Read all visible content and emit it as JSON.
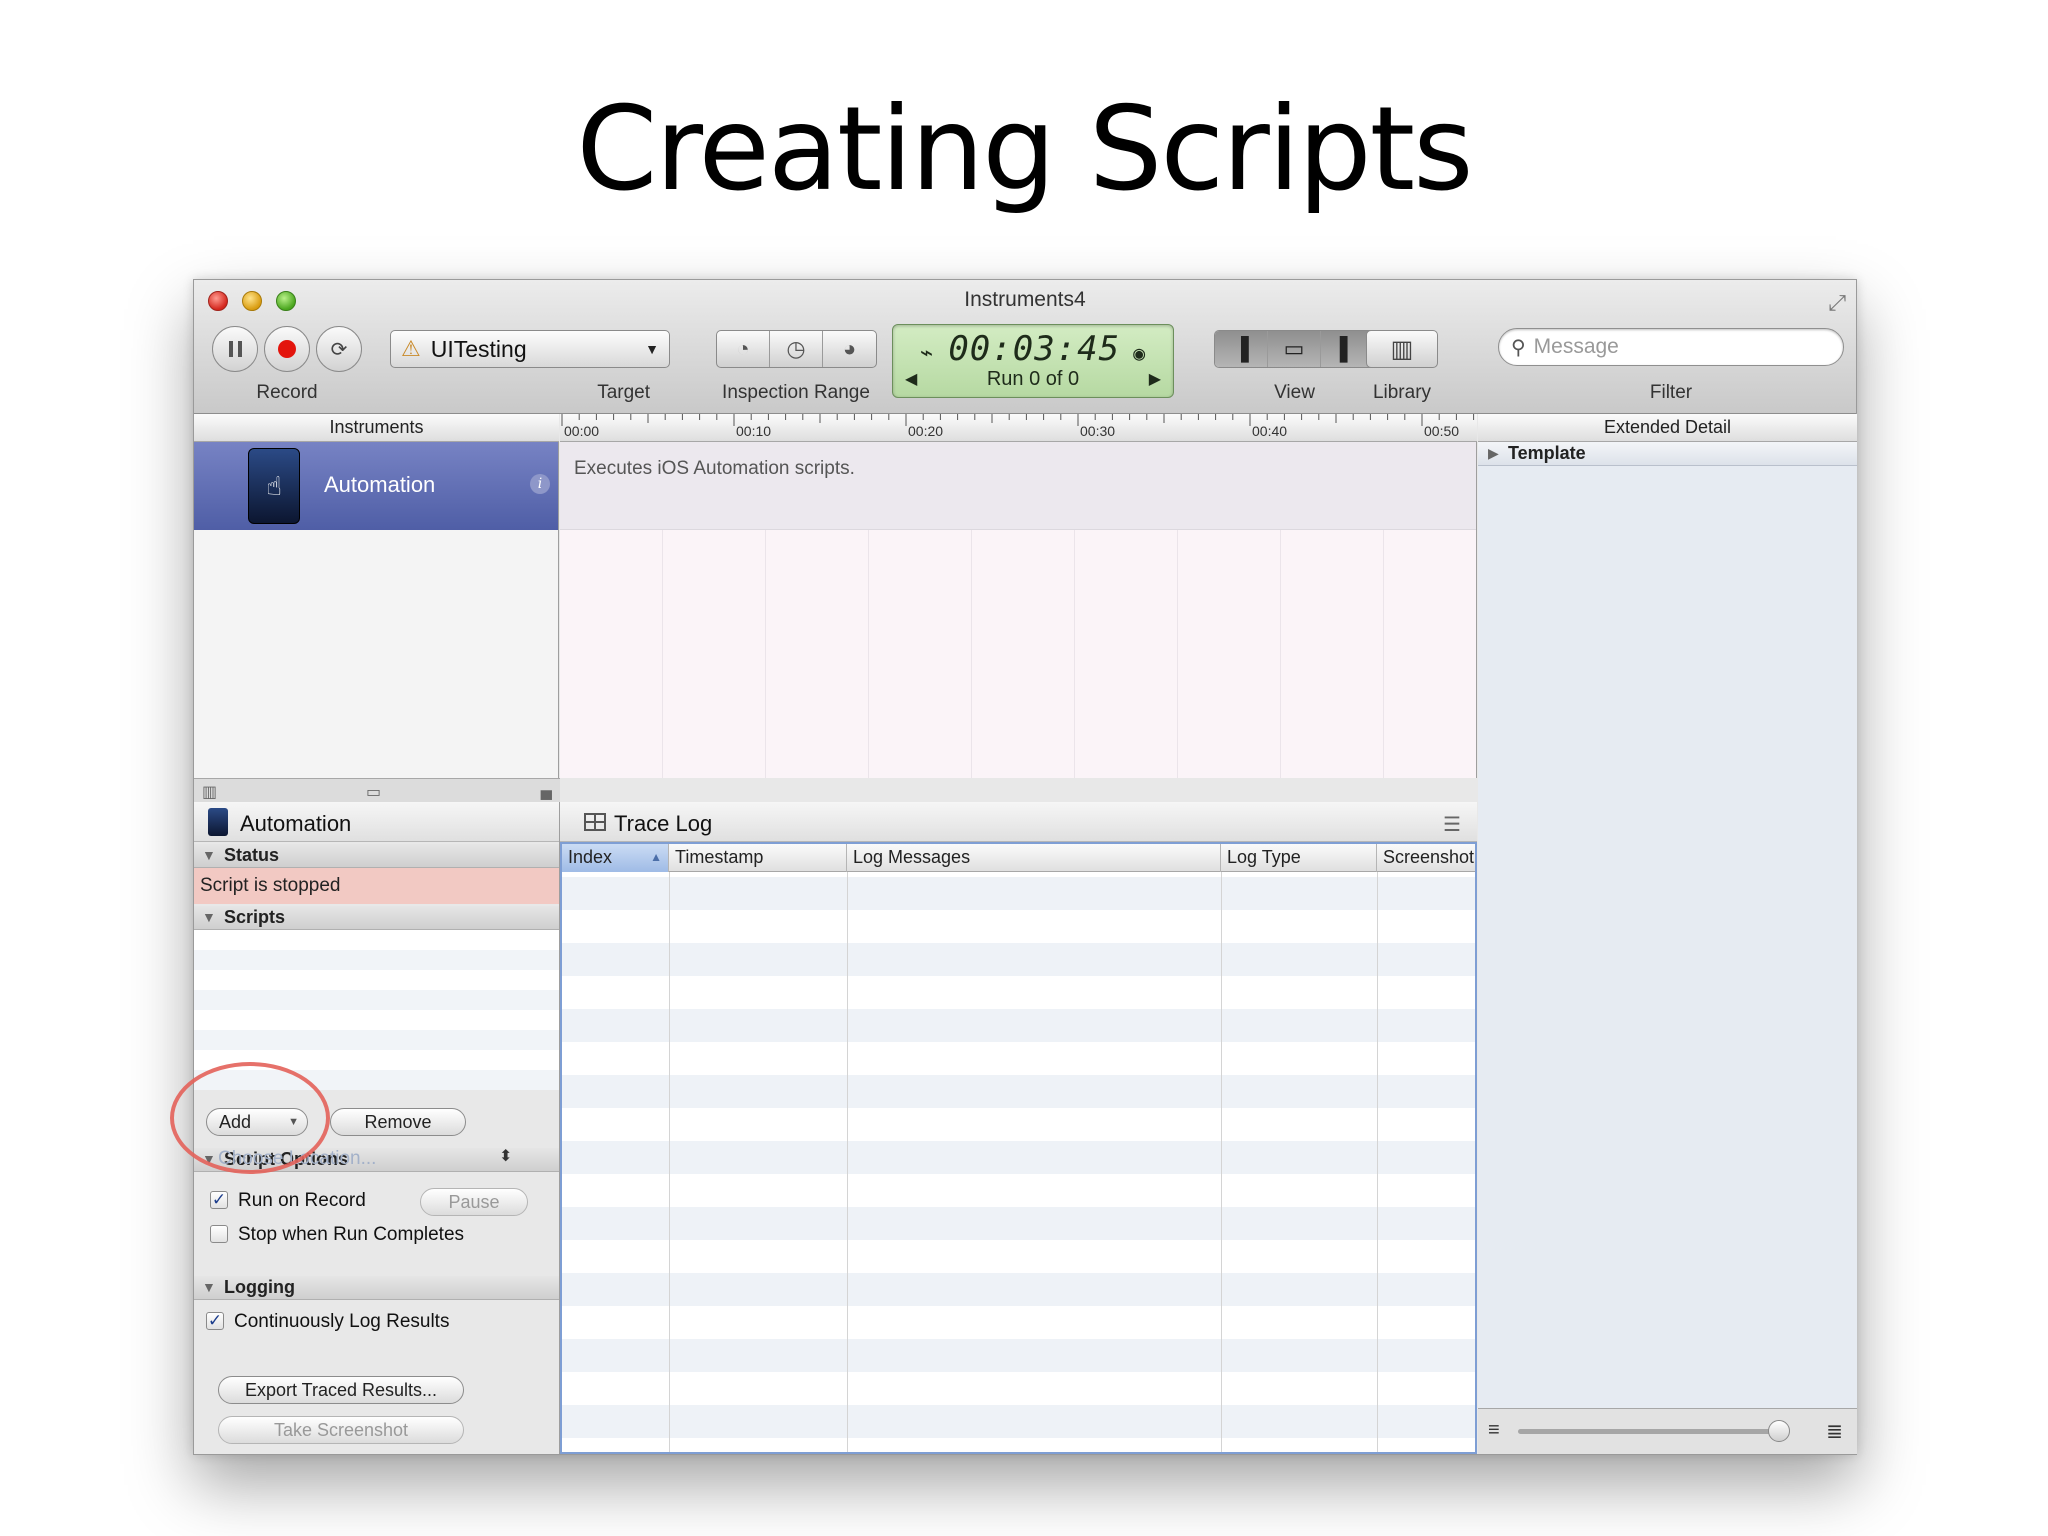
{
  "slide_title": "Creating Scripts",
  "window": {
    "title": "Instruments4"
  },
  "toolbar": {
    "record_label": "Record",
    "target_label": "Target",
    "target_value": "UITesting",
    "inspection_range_label": "Inspection Range",
    "timer": "00:03:45",
    "run_status": "Run 0 of 0",
    "view_label": "View",
    "library_label": "Library",
    "filter_label": "Filter",
    "filter_placeholder": "Message"
  },
  "instruments": {
    "header": "Instruments",
    "items": [
      {
        "name": "Automation",
        "description": "Executes iOS Automation scripts."
      }
    ]
  },
  "timeline": {
    "ticks": [
      "00:00",
      "00:10",
      "00:20",
      "00:30",
      "00:40",
      "00:50"
    ]
  },
  "extended_detail": {
    "header": "Extended Detail",
    "template_label": "Template"
  },
  "automation_pane": {
    "title": "Automation",
    "status_section": "Status",
    "status_text": "Script is stopped",
    "scripts_section": "Scripts",
    "add_button": "Add",
    "remove_button": "Remove",
    "script_options_section": "Script Options",
    "run_on_record": {
      "label": "Run on Record",
      "checked": true
    },
    "pause_button": "Pause",
    "stop_when_complete": {
      "label": "Stop when Run Completes",
      "checked": false
    },
    "logging_section": "Logging",
    "continuously_log": {
      "label": "Continuously Log Results",
      "checked": true
    },
    "choose_location": "Choose Location...",
    "export_button": "Export Traced Results...",
    "screenshot_button": "Take Screenshot"
  },
  "trace_log": {
    "title": "Trace Log",
    "columns": [
      "Index",
      "Timestamp",
      "Log Messages",
      "Log Type",
      "Screenshot"
    ],
    "sorted_column": "Index"
  },
  "colors": {
    "selected_instrument": "#5a68ad",
    "status_bg": "#f2c9c3",
    "lcd_bg": "#c5e3b3",
    "highlight_ring": "#e3625a",
    "table_border": "#7e9ed4"
  }
}
